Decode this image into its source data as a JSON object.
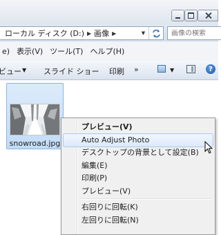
{
  "address": {
    "breadcrumb": [
      "ローカル ディスク (D:)",
      "画像"
    ],
    "search_placeholder": "画像の検索"
  },
  "menubar": {
    "items": [
      "e)",
      "表示(V)",
      "ツール(T)",
      "ヘルプ(H)"
    ]
  },
  "command_bar": {
    "preview": "ビュー",
    "slideshow": "スライド ショー",
    "print": "印刷",
    "more": "»",
    "help": "?"
  },
  "file": {
    "name": "snowroad.jpg"
  },
  "context_menu": {
    "items": [
      "プレビュー(V)",
      "Auto Adjust Photo",
      "デスクトップの背景として設定(B)",
      "編集(E)",
      "印刷(P)",
      "プレビュー(V)",
      "右回りに回転(K)",
      "左回りに回転(N)"
    ]
  },
  "icons": {
    "minimize": "minimize-icon",
    "maximize": "maximize-icon",
    "close": "close-icon",
    "refresh": "refresh-icon",
    "search": "search-icon",
    "views": "views-icon",
    "preview_pane": "preview-pane-icon",
    "help": "help-icon",
    "cursor": "mouse-cursor-icon"
  }
}
